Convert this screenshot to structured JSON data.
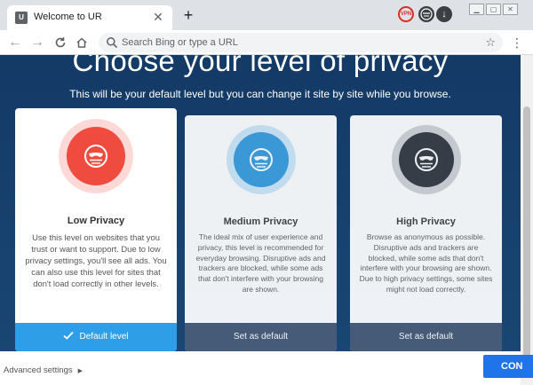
{
  "browser": {
    "tab_title": "Welcome to UR",
    "tab_favicon_text": "U",
    "new_tab_symbol": "+",
    "close_symbol": "✕",
    "extensions": {
      "vpn_label": "VPN"
    },
    "omnibox_placeholder": "Search Bing or type a URL",
    "colors": {
      "tab_strip": "#dee1e6",
      "accent": "#1e74e8"
    }
  },
  "page": {
    "title": "Choose your level of privacy",
    "subtitle": "This will be your default level but you can change it site by site while you browse.",
    "cards": [
      {
        "id": "low",
        "title": "Low Privacy",
        "description": "Use this level on websites that you trust or want to support. Due to low privacy settings, you'll see all ads. You can also use this level for sites that don't load correctly in other levels.",
        "action_label": "Default level",
        "selected": true,
        "icon": "mask-icon",
        "color": "#ef4b3f"
      },
      {
        "id": "medium",
        "title": "Medium Privacy",
        "description": "The ideal mix of user experience and privacy, this level is recommended for everyday browsing. Disruptive ads and trackers are blocked, while some ads that don't interfere with your browsing are shown.",
        "action_label": "Set as default",
        "selected": false,
        "icon": "mask-icon",
        "color": "#3e9fe0"
      },
      {
        "id": "high",
        "title": "High Privacy",
        "description": "Browse as anonymous as possible. Disruptive ads and trackers are blocked, while some ads that don't interfere with your browsing are shown. Due to high privacy settings, some sites might not load correctly.",
        "action_label": "Set as default",
        "selected": false,
        "icon": "mask-icon",
        "color": "#3a3d44"
      }
    ],
    "footer": {
      "advanced_label": "Advanced settings",
      "continue_label": "CON"
    }
  }
}
